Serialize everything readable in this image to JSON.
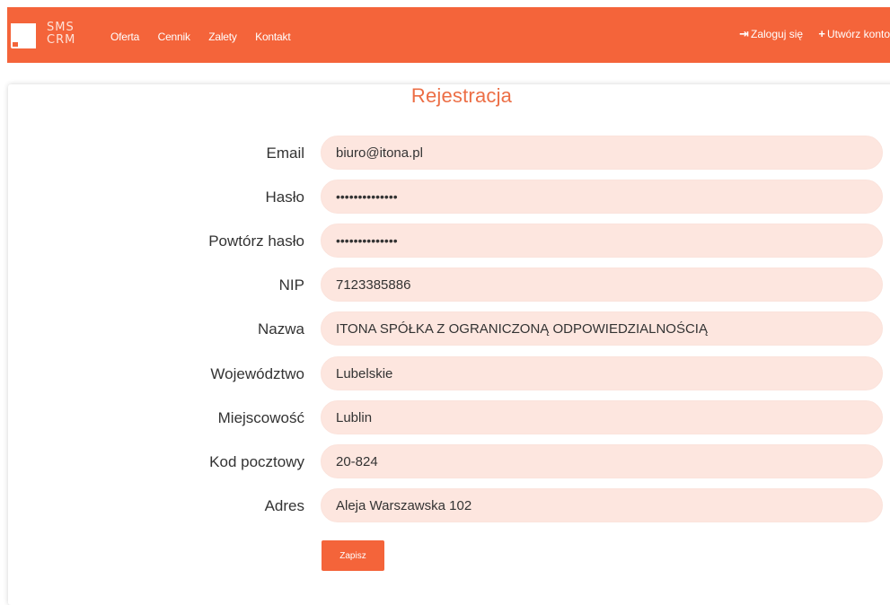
{
  "navbar": {
    "logo": {
      "line1": "SMS",
      "line2": "CRM"
    },
    "links": [
      "Oferta",
      "Cennik",
      "Zalety",
      "Kontakt"
    ],
    "login_label": "Zaloguj się",
    "register_label": "Utwórz konto"
  },
  "form": {
    "title": "Rejestracja",
    "fields": [
      {
        "label": "Email",
        "value": "biuro@itona.pl"
      },
      {
        "label": "Hasło",
        "value": "••••••••••••••"
      },
      {
        "label": "Powtórz hasło",
        "value": "••••••••••••••"
      },
      {
        "label": "NIP",
        "value": "7123385886"
      },
      {
        "label": "Nazwa",
        "value": "ITONA SPÓŁKA Z OGRANICZONĄ ODPOWIEDZIALNOŚCIĄ"
      },
      {
        "label": "Województwo",
        "value": "Lubelskie"
      },
      {
        "label": "Miejscowość",
        "value": "Lublin"
      },
      {
        "label": "Kod pocztowy",
        "value": "20-824"
      },
      {
        "label": "Adres",
        "value": "Aleja Warszawska 102"
      }
    ],
    "submit_label": "Zapisz"
  },
  "colors": {
    "accent": "#f4643a",
    "field_bg": "#fde6df",
    "title": "#ec6e45"
  }
}
